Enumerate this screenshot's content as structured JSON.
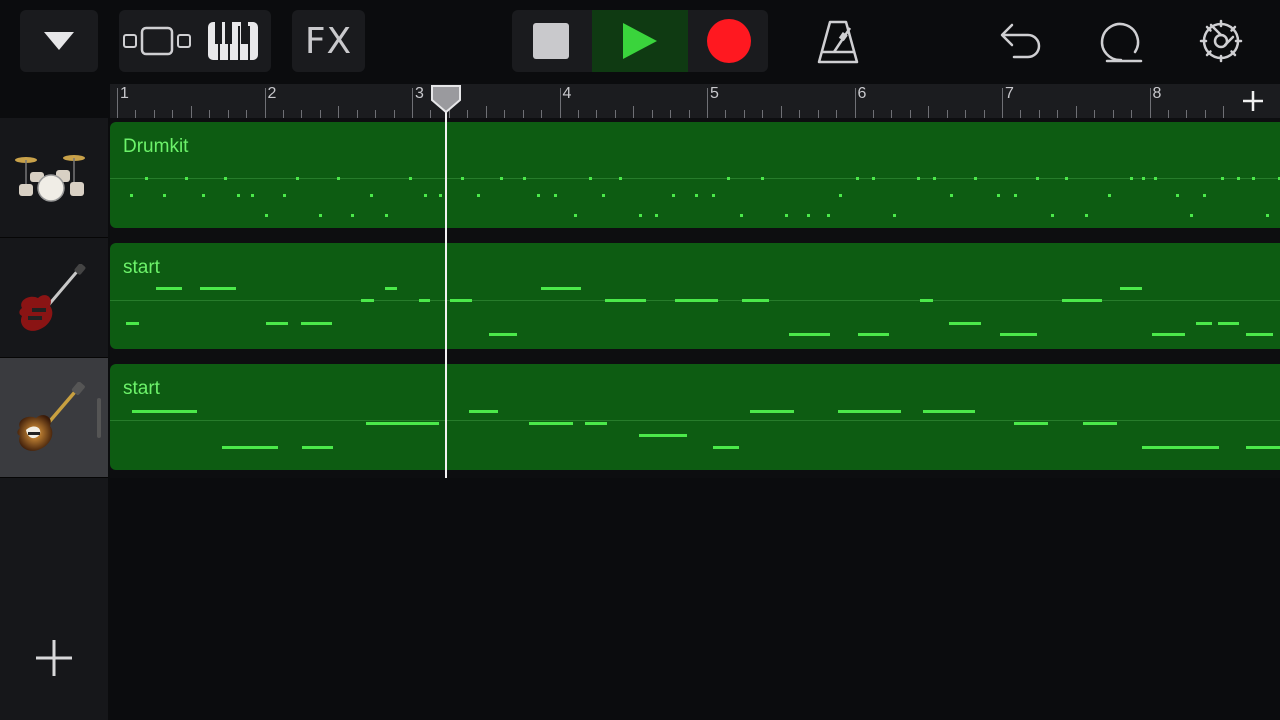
{
  "toolbar": {
    "fx_label": "FX",
    "icons": [
      "dropdown-arrow-icon",
      "tracks-view-icon",
      "keyboard-icon",
      "fx-icon",
      "stop-icon",
      "play-icon",
      "record-icon",
      "metronome-icon",
      "undo-icon",
      "loop-icon",
      "settings-icon"
    ],
    "colors": {
      "play": "#3ad43c",
      "play_bg": "#0f3a12",
      "record": "#ff1820",
      "stop": "#c9c9cc"
    }
  },
  "ruler": {
    "bars": [
      "1",
      "2",
      "3",
      "4",
      "5",
      "6",
      "7",
      "8"
    ],
    "add_section_icon": "plus-icon"
  },
  "tracks": [
    {
      "instrument": "drum-kit-icon",
      "region_label": "Drumkit",
      "type": "drums"
    },
    {
      "instrument": "electric-guitar-icon",
      "region_label": "start",
      "type": "guitar"
    },
    {
      "instrument": "bass-guitar-icon",
      "region_label": "start",
      "type": "bass",
      "selected": true
    }
  ],
  "add_track_icon": "plus-icon",
  "colors": {
    "region": "#0d5c12",
    "note": "#4be94a",
    "region_text": "#6cf26a"
  }
}
